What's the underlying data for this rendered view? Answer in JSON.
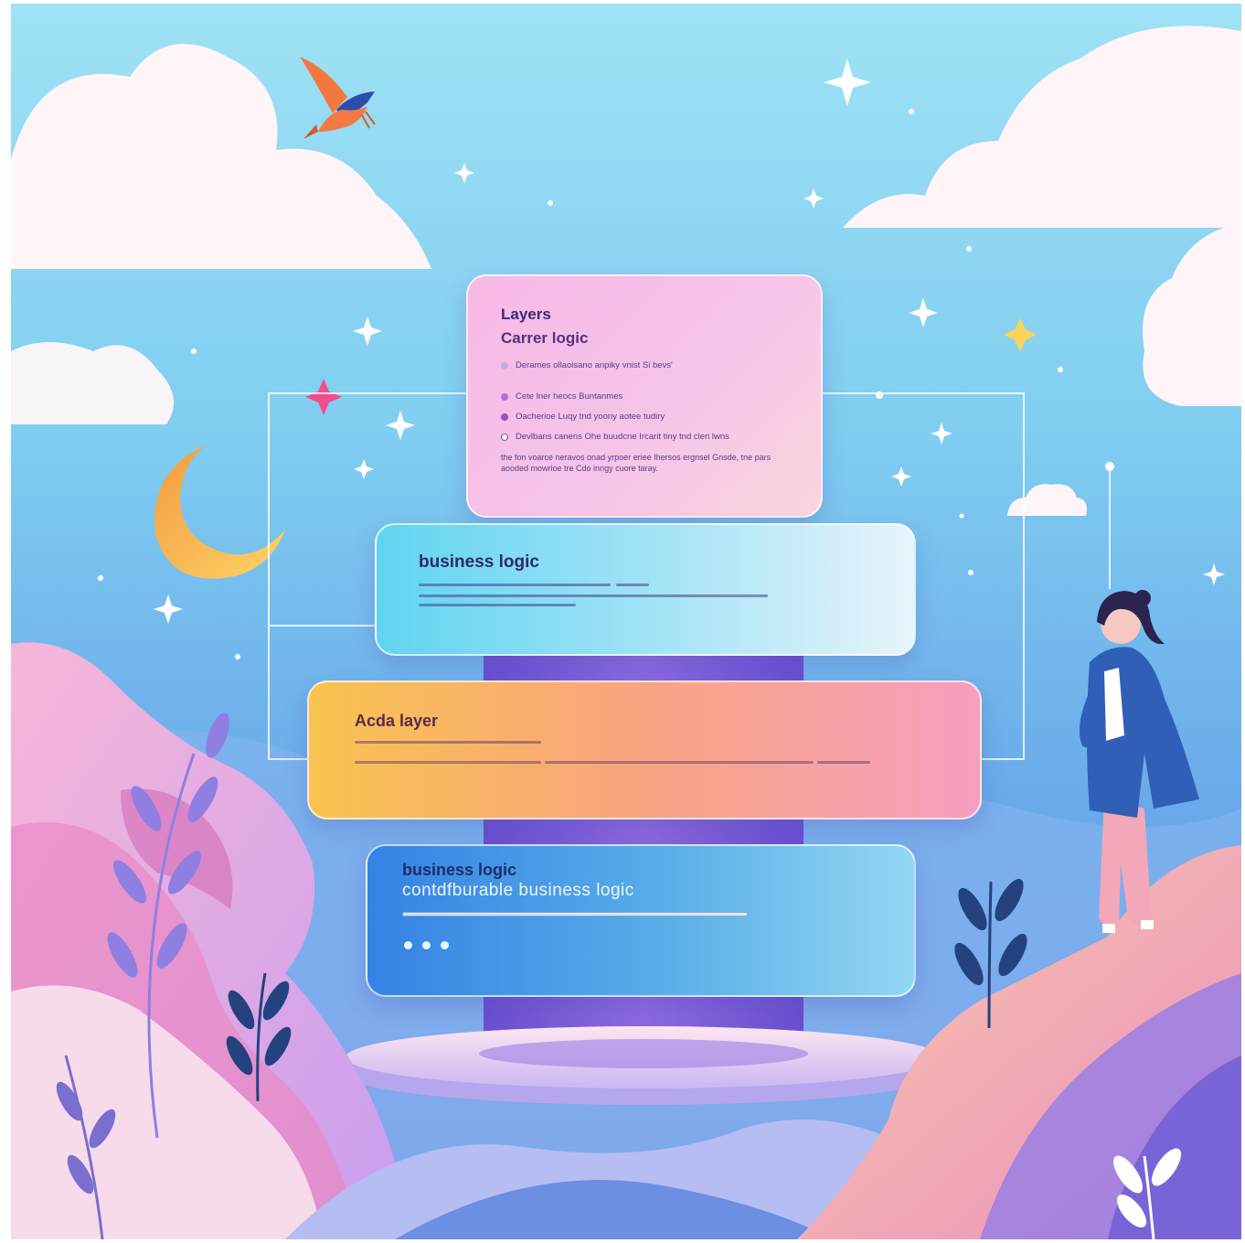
{
  "layers": {
    "top": {
      "heading": "Layers",
      "subheading": "Carrer logic",
      "bullets": [
        "Derames  ollaoisano anpiky  vnist Si bevs'",
        "Cete lner heocs  Buntanmes",
        "Oacherioe Luqy tnd yoony aotee tudiry",
        "Devlbans  canens  Ohe buudcne  Ircarit tiny  tnd  cleri lwns"
      ],
      "bullet_colors": [
        "#c9a7e8",
        "#b36fd0",
        "#9a4fc6",
        "#ffffff"
      ],
      "paragraph": "the fon voarce neravos onad yrpoer eriee Ihersos ergnsel Gnsde, tne pars aooded mowrioe tre Cdo inngy cuore taray."
    },
    "business": {
      "heading": "business logic"
    },
    "data": {
      "heading": "Acda layer"
    },
    "config": {
      "heading": "business logic",
      "subheading": "contdfburable business logic"
    }
  },
  "colors": {
    "sky_top": "#9fe2f5",
    "pillar": "#7b5bd6",
    "pink_hill": "#f3a9d6",
    "peach_hill": "#f6b39c"
  },
  "icons": [
    "bird-icon",
    "moon-icon",
    "sparkle-icon",
    "cloud-icon",
    "leaf-icon",
    "person-figure"
  ]
}
